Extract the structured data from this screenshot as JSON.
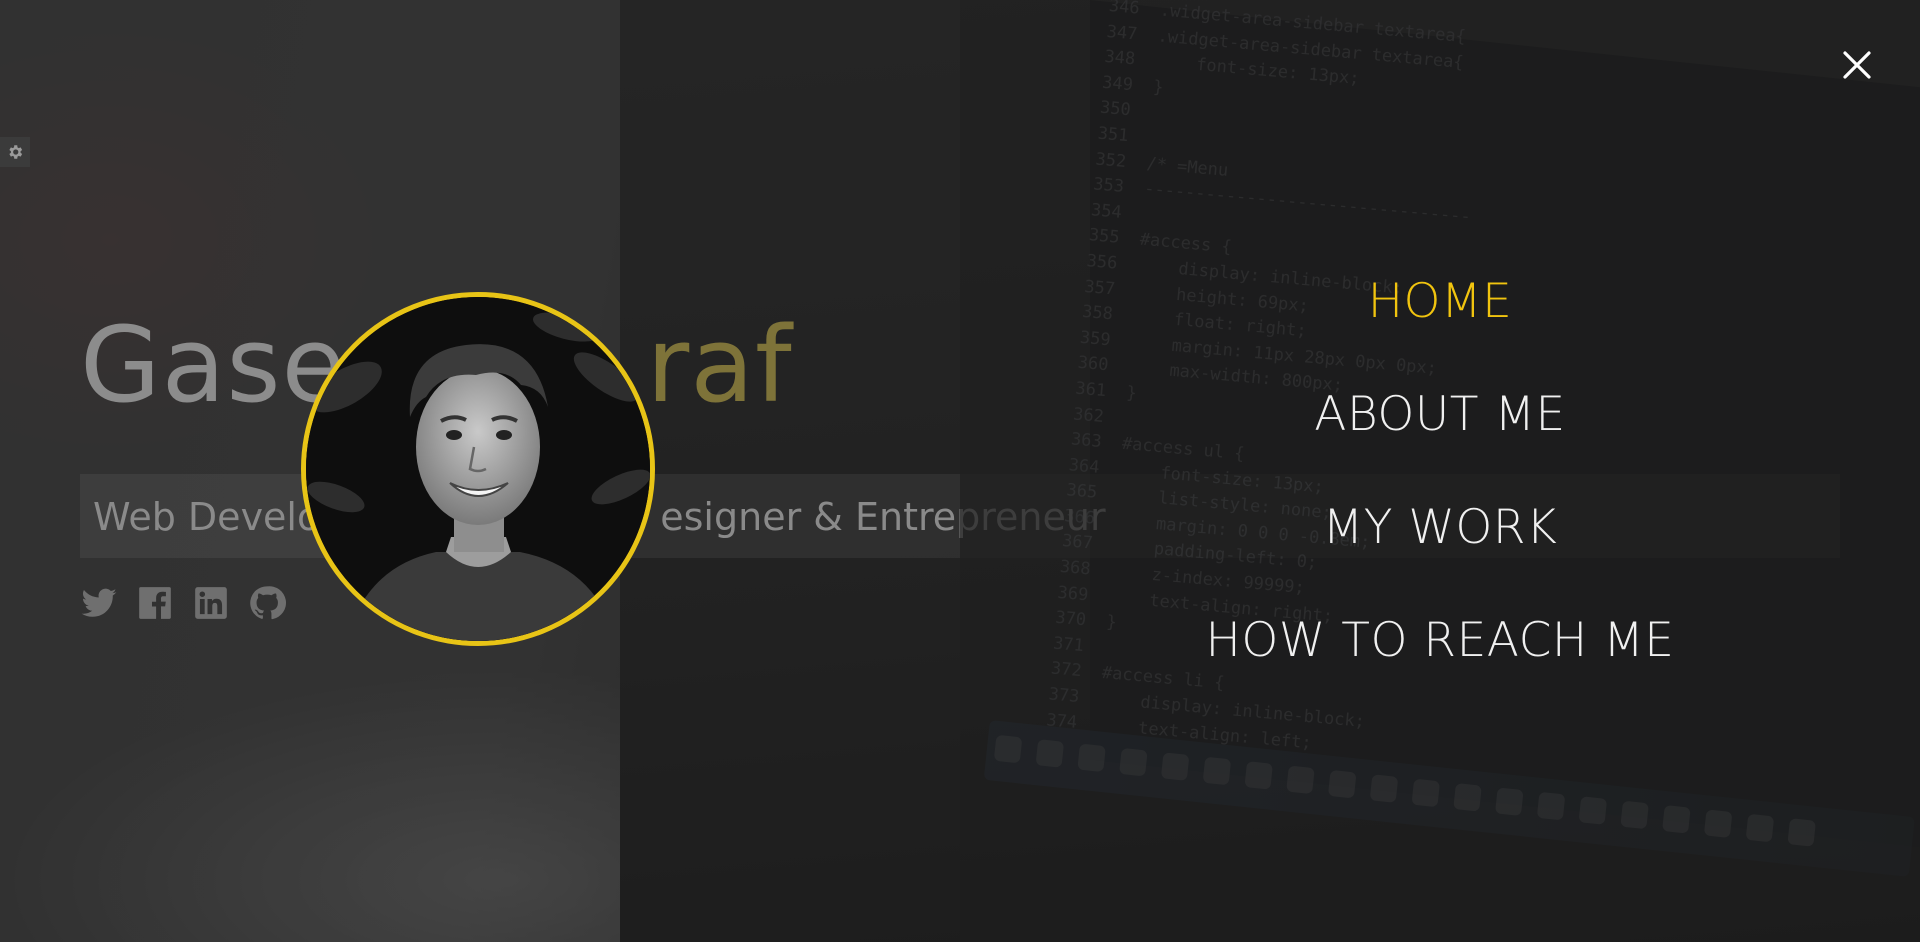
{
  "hero": {
    "name_first": "Gase",
    "name_last": "raf",
    "tagline_left": "Web Develo",
    "tagline_right": "esigner & Entrepreneur"
  },
  "social_icons": [
    "twitter-icon",
    "facebook-icon",
    "linkedin-icon",
    "github-icon"
  ],
  "settings_icon": "gear-icon",
  "menu": {
    "items": [
      {
        "label": "HOME",
        "active": true
      },
      {
        "label": "ABOUT ME",
        "active": false
      },
      {
        "label": "MY WORK",
        "active": false
      },
      {
        "label": "HOW TO REACH ME",
        "active": false
      }
    ],
    "close_icon": "close-icon"
  },
  "background_code": {
    "lines": [
      "346  .widget-area-sidebar textarea{",
      "347  .widget-area-sidebar textarea{",
      "348      font-size: 13px;",
      "349  }",
      "350",
      "351",
      "352  /* =Menu",
      "353  --------------------------------",
      "354",
      "355  #access {",
      "356      display: inline-block;",
      "357      height: 69px;",
      "358      float: right;",
      "359      margin: 11px 28px 0px 0px;",
      "360      max-width: 800px;",
      "361  }",
      "362",
      "363  #access ul {",
      "364      font-size: 13px;",
      "365      list-style: none;",
      "366      margin: 0 0 0 -0.8em;",
      "367      padding-left: 0;",
      "368      z-index: 99999;",
      "369      text-align: right;",
      "370  }",
      "371",
      "372  #access li {",
      "373      display: inline-block;",
      "374      text-align: left;"
    ]
  },
  "colors": {
    "accent": "#f1c40f",
    "avatar_border": "#e8c416",
    "menu_text": "#f0f0f0"
  }
}
